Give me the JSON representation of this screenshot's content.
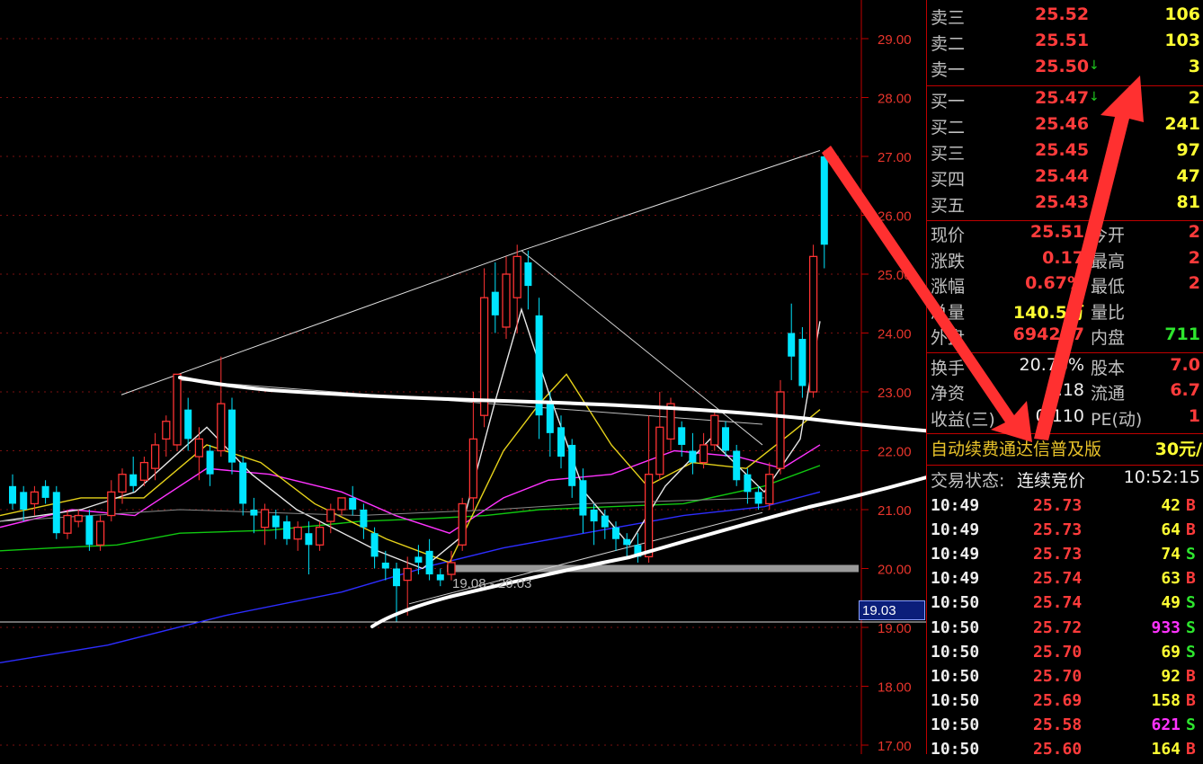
{
  "chart_data": {
    "type": "candlestick",
    "y_ticks": [
      "29.00",
      "28.00",
      "27.00",
      "26.00",
      "25.00",
      "24.00",
      "23.00",
      "22.00",
      "21.00",
      "20.00",
      "19.00",
      "18.00",
      "17.00"
    ],
    "ylim": [
      17.0,
      29.6
    ],
    "current_price_tag": "19.03",
    "range_label": "19.08 - 20.03",
    "candles": [
      {
        "o": 21.4,
        "c": 21.1,
        "h": 21.6,
        "l": 21.0,
        "up": false
      },
      {
        "o": 21.3,
        "c": 21.0,
        "h": 21.4,
        "l": 20.8,
        "up": false
      },
      {
        "o": 21.1,
        "c": 21.3,
        "h": 21.4,
        "l": 20.9,
        "up": true
      },
      {
        "o": 21.4,
        "c": 21.2,
        "h": 21.5,
        "l": 21.1,
        "up": false
      },
      {
        "o": 21.3,
        "c": 20.6,
        "h": 21.4,
        "l": 20.5,
        "up": false
      },
      {
        "o": 20.6,
        "c": 20.9,
        "h": 21.0,
        "l": 20.5,
        "up": true
      },
      {
        "o": 20.8,
        "c": 20.9,
        "h": 21.0,
        "l": 20.7,
        "up": true
      },
      {
        "o": 20.9,
        "c": 20.4,
        "h": 21.0,
        "l": 20.3,
        "up": false
      },
      {
        "o": 20.4,
        "c": 20.8,
        "h": 20.9,
        "l": 20.3,
        "up": true
      },
      {
        "o": 20.9,
        "c": 21.3,
        "h": 21.5,
        "l": 20.8,
        "up": true
      },
      {
        "o": 21.3,
        "c": 21.6,
        "h": 21.7,
        "l": 21.1,
        "up": true
      },
      {
        "o": 21.6,
        "c": 21.4,
        "h": 21.9,
        "l": 21.3,
        "up": false
      },
      {
        "o": 21.5,
        "c": 21.8,
        "h": 21.9,
        "l": 21.4,
        "up": true
      },
      {
        "o": 21.7,
        "c": 22.1,
        "h": 22.3,
        "l": 21.5,
        "up": true
      },
      {
        "o": 22.2,
        "c": 22.5,
        "h": 22.6,
        "l": 21.9,
        "up": true
      },
      {
        "o": 22.1,
        "c": 23.3,
        "h": 23.3,
        "l": 22.0,
        "up": true
      },
      {
        "o": 22.7,
        "c": 22.2,
        "h": 22.9,
        "l": 22.0,
        "up": false
      },
      {
        "o": 21.9,
        "c": 22.2,
        "h": 22.4,
        "l": 21.5,
        "up": true
      },
      {
        "o": 22.0,
        "c": 21.6,
        "h": 22.1,
        "l": 21.4,
        "up": false
      },
      {
        "o": 22.0,
        "c": 22.8,
        "h": 23.6,
        "l": 21.9,
        "up": true
      },
      {
        "o": 22.7,
        "c": 21.8,
        "h": 22.9,
        "l": 21.6,
        "up": false
      },
      {
        "o": 21.8,
        "c": 21.1,
        "h": 21.9,
        "l": 20.9,
        "up": false
      },
      {
        "o": 21.0,
        "c": 20.9,
        "h": 21.2,
        "l": 20.6,
        "up": false
      },
      {
        "o": 20.7,
        "c": 21.0,
        "h": 21.1,
        "l": 20.4,
        "up": true
      },
      {
        "o": 20.9,
        "c": 20.7,
        "h": 21.0,
        "l": 20.5,
        "up": false
      },
      {
        "o": 20.8,
        "c": 20.5,
        "h": 20.9,
        "l": 20.4,
        "up": false
      },
      {
        "o": 20.5,
        "c": 20.7,
        "h": 20.8,
        "l": 20.3,
        "up": true
      },
      {
        "o": 20.6,
        "c": 20.4,
        "h": 20.8,
        "l": 19.9,
        "up": false
      },
      {
        "o": 20.4,
        "c": 20.7,
        "h": 20.8,
        "l": 20.3,
        "up": true
      },
      {
        "o": 20.8,
        "c": 21.0,
        "h": 21.1,
        "l": 20.6,
        "up": true
      },
      {
        "o": 21.0,
        "c": 21.2,
        "h": 21.2,
        "l": 20.9,
        "up": true
      },
      {
        "o": 21.2,
        "c": 21.0,
        "h": 21.4,
        "l": 20.9,
        "up": false
      },
      {
        "o": 21.0,
        "c": 20.7,
        "h": 21.1,
        "l": 20.5,
        "up": false
      },
      {
        "o": 20.6,
        "c": 20.2,
        "h": 20.7,
        "l": 20.0,
        "up": false
      },
      {
        "o": 20.1,
        "c": 20.0,
        "h": 20.3,
        "l": 19.8,
        "up": false
      },
      {
        "o": 20.0,
        "c": 19.7,
        "h": 20.1,
        "l": 19.1,
        "up": false
      },
      {
        "o": 19.8,
        "c": 20.0,
        "h": 20.2,
        "l": 19.2,
        "up": true
      },
      {
        "o": 20.2,
        "c": 20.1,
        "h": 20.4,
        "l": 19.9,
        "up": false
      },
      {
        "o": 20.3,
        "c": 19.9,
        "h": 20.5,
        "l": 19.8,
        "up": false
      },
      {
        "o": 19.9,
        "c": 19.8,
        "h": 20.0,
        "l": 19.7,
        "up": false
      },
      {
        "o": 19.9,
        "c": 20.1,
        "h": 20.3,
        "l": 19.8,
        "up": true
      },
      {
        "o": 20.4,
        "c": 21.1,
        "h": 21.2,
        "l": 20.3,
        "up": true
      },
      {
        "o": 21.2,
        "c": 22.2,
        "h": 23.0,
        "l": 21.0,
        "up": true
      },
      {
        "o": 22.6,
        "c": 24.6,
        "h": 25.1,
        "l": 22.4,
        "up": true
      },
      {
        "o": 24.7,
        "c": 24.3,
        "h": 25.2,
        "l": 24.0,
        "up": false
      },
      {
        "o": 24.1,
        "c": 25.0,
        "h": 25.3,
        "l": 23.9,
        "up": true
      },
      {
        "o": 24.6,
        "c": 25.3,
        "h": 25.5,
        "l": 24.0,
        "up": true
      },
      {
        "o": 25.2,
        "c": 24.8,
        "h": 25.4,
        "l": 24.4,
        "up": false
      },
      {
        "o": 24.3,
        "c": 22.6,
        "h": 24.6,
        "l": 22.2,
        "up": false
      },
      {
        "o": 22.8,
        "c": 22.3,
        "h": 23.0,
        "l": 21.9,
        "up": false
      },
      {
        "o": 22.4,
        "c": 21.9,
        "h": 22.6,
        "l": 21.7,
        "up": false
      },
      {
        "o": 22.1,
        "c": 21.4,
        "h": 22.2,
        "l": 21.2,
        "up": false
      },
      {
        "o": 21.5,
        "c": 20.9,
        "h": 21.7,
        "l": 20.6,
        "up": false
      },
      {
        "o": 21.0,
        "c": 20.8,
        "h": 21.1,
        "l": 20.4,
        "up": false
      },
      {
        "o": 20.9,
        "c": 20.7,
        "h": 21.0,
        "l": 20.5,
        "up": false
      },
      {
        "o": 20.7,
        "c": 20.5,
        "h": 20.8,
        "l": 20.3,
        "up": false
      },
      {
        "o": 20.5,
        "c": 20.4,
        "h": 20.6,
        "l": 20.2,
        "up": false
      },
      {
        "o": 20.4,
        "c": 20.2,
        "h": 20.6,
        "l": 20.1,
        "up": false
      },
      {
        "o": 20.2,
        "c": 21.6,
        "h": 22.6,
        "l": 20.1,
        "up": true
      },
      {
        "o": 21.6,
        "c": 22.4,
        "h": 23.0,
        "l": 21.5,
        "up": true
      },
      {
        "o": 22.2,
        "c": 22.8,
        "h": 22.9,
        "l": 22.0,
        "up": true
      },
      {
        "o": 22.4,
        "c": 22.1,
        "h": 22.5,
        "l": 21.9,
        "up": false
      },
      {
        "o": 22.0,
        "c": 21.8,
        "h": 22.3,
        "l": 21.6,
        "up": false
      },
      {
        "o": 21.8,
        "c": 22.1,
        "h": 22.3,
        "l": 21.7,
        "up": true
      },
      {
        "o": 22.1,
        "c": 22.6,
        "h": 22.7,
        "l": 22.0,
        "up": true
      },
      {
        "o": 22.4,
        "c": 22.0,
        "h": 22.5,
        "l": 21.9,
        "up": false
      },
      {
        "o": 22.0,
        "c": 21.5,
        "h": 22.1,
        "l": 21.4,
        "up": false
      },
      {
        "o": 21.6,
        "c": 21.3,
        "h": 21.7,
        "l": 21.1,
        "up": false
      },
      {
        "o": 21.3,
        "c": 21.1,
        "h": 21.4,
        "l": 21.0,
        "up": false
      },
      {
        "o": 21.1,
        "c": 21.6,
        "h": 21.8,
        "l": 21.0,
        "up": true
      },
      {
        "o": 21.7,
        "c": 23.0,
        "h": 23.2,
        "l": 21.6,
        "up": true
      },
      {
        "o": 23.6,
        "c": 24.0,
        "h": 24.5,
        "l": 23.2,
        "up": false
      },
      {
        "o": 23.9,
        "c": 23.1,
        "h": 24.1,
        "l": 22.9,
        "up": false
      },
      {
        "o": 23.0,
        "c": 25.3,
        "h": 25.5,
        "l": 22.9,
        "up": true
      },
      {
        "o": 25.5,
        "c": 27.0,
        "h": 27.1,
        "l": 25.1,
        "up": false
      }
    ]
  },
  "order_book": {
    "asks": [
      {
        "label": "卖三",
        "price": "25.52",
        "vol": "106",
        "arrow": ""
      },
      {
        "label": "卖二",
        "price": "25.51",
        "vol": "103",
        "arrow": ""
      },
      {
        "label": "卖一",
        "price": "25.50",
        "vol": "3",
        "arrow": "↓"
      }
    ],
    "bids": [
      {
        "label": "买一",
        "price": "25.47",
        "vol": "2",
        "arrow": "↓"
      },
      {
        "label": "买二",
        "price": "25.46",
        "vol": "241",
        "arrow": ""
      },
      {
        "label": "买三",
        "price": "25.45",
        "vol": "97",
        "arrow": ""
      },
      {
        "label": "买四",
        "price": "25.44",
        "vol": "47",
        "arrow": ""
      },
      {
        "label": "买五",
        "price": "25.43",
        "vol": "81",
        "arrow": ""
      }
    ]
  },
  "quote": [
    {
      "l1": "现价",
      "v1": "25.51",
      "l2": "今开",
      "v2": "2"
    },
    {
      "l1": "涨跌",
      "v1": "0.17",
      "l2": "最高",
      "v2": "2"
    },
    {
      "l1": "涨幅",
      "v1": "0.67%",
      "l2": "最低",
      "v2": "2"
    },
    {
      "l1": "总量",
      "v1": "140.5万",
      "l2": "量比",
      "v2": ""
    },
    {
      "l1": "外盘",
      "v1": "694257",
      "l2": "内盘",
      "v2": "711"
    }
  ],
  "fundamentals": [
    {
      "l1": "换手",
      "v1": "20.78%",
      "l2": "股本",
      "v2": "7.0"
    },
    {
      "l1": "净资",
      "v1": "5.18",
      "l2": "流通",
      "v2": "6.7"
    },
    {
      "l1": "收益(三)",
      "v1": "0.110",
      "l2": "PE(动)",
      "v2": "1"
    }
  ],
  "promo": {
    "text": "自动续费通达信普及版",
    "price": "30元/"
  },
  "status": {
    "label": "交易状态:",
    "value": "连续竞价",
    "time": "10:52:15"
  },
  "trades": [
    {
      "t": "10:49",
      "p": "25.73",
      "v": "42",
      "s": "B",
      "big": false
    },
    {
      "t": "10:49",
      "p": "25.73",
      "v": "64",
      "s": "B",
      "big": false
    },
    {
      "t": "10:49",
      "p": "25.73",
      "v": "74",
      "s": "S",
      "big": false
    },
    {
      "t": "10:49",
      "p": "25.74",
      "v": "63",
      "s": "B",
      "big": false
    },
    {
      "t": "10:50",
      "p": "25.74",
      "v": "49",
      "s": "S",
      "big": false
    },
    {
      "t": "10:50",
      "p": "25.72",
      "v": "933",
      "s": "S",
      "big": true
    },
    {
      "t": "10:50",
      "p": "25.70",
      "v": "69",
      "s": "S",
      "big": false
    },
    {
      "t": "10:50",
      "p": "25.70",
      "v": "92",
      "s": "B",
      "big": false
    },
    {
      "t": "10:50",
      "p": "25.69",
      "v": "158",
      "s": "B",
      "big": false
    },
    {
      "t": "10:50",
      "p": "25.58",
      "v": "621",
      "s": "S",
      "big": true
    },
    {
      "t": "10:50",
      "p": "25.60",
      "v": "164",
      "s": "B",
      "big": false
    }
  ],
  "colors": {
    "up": "#ff3333",
    "down": "#00e5ff",
    "panelBorder": "#c00000"
  }
}
